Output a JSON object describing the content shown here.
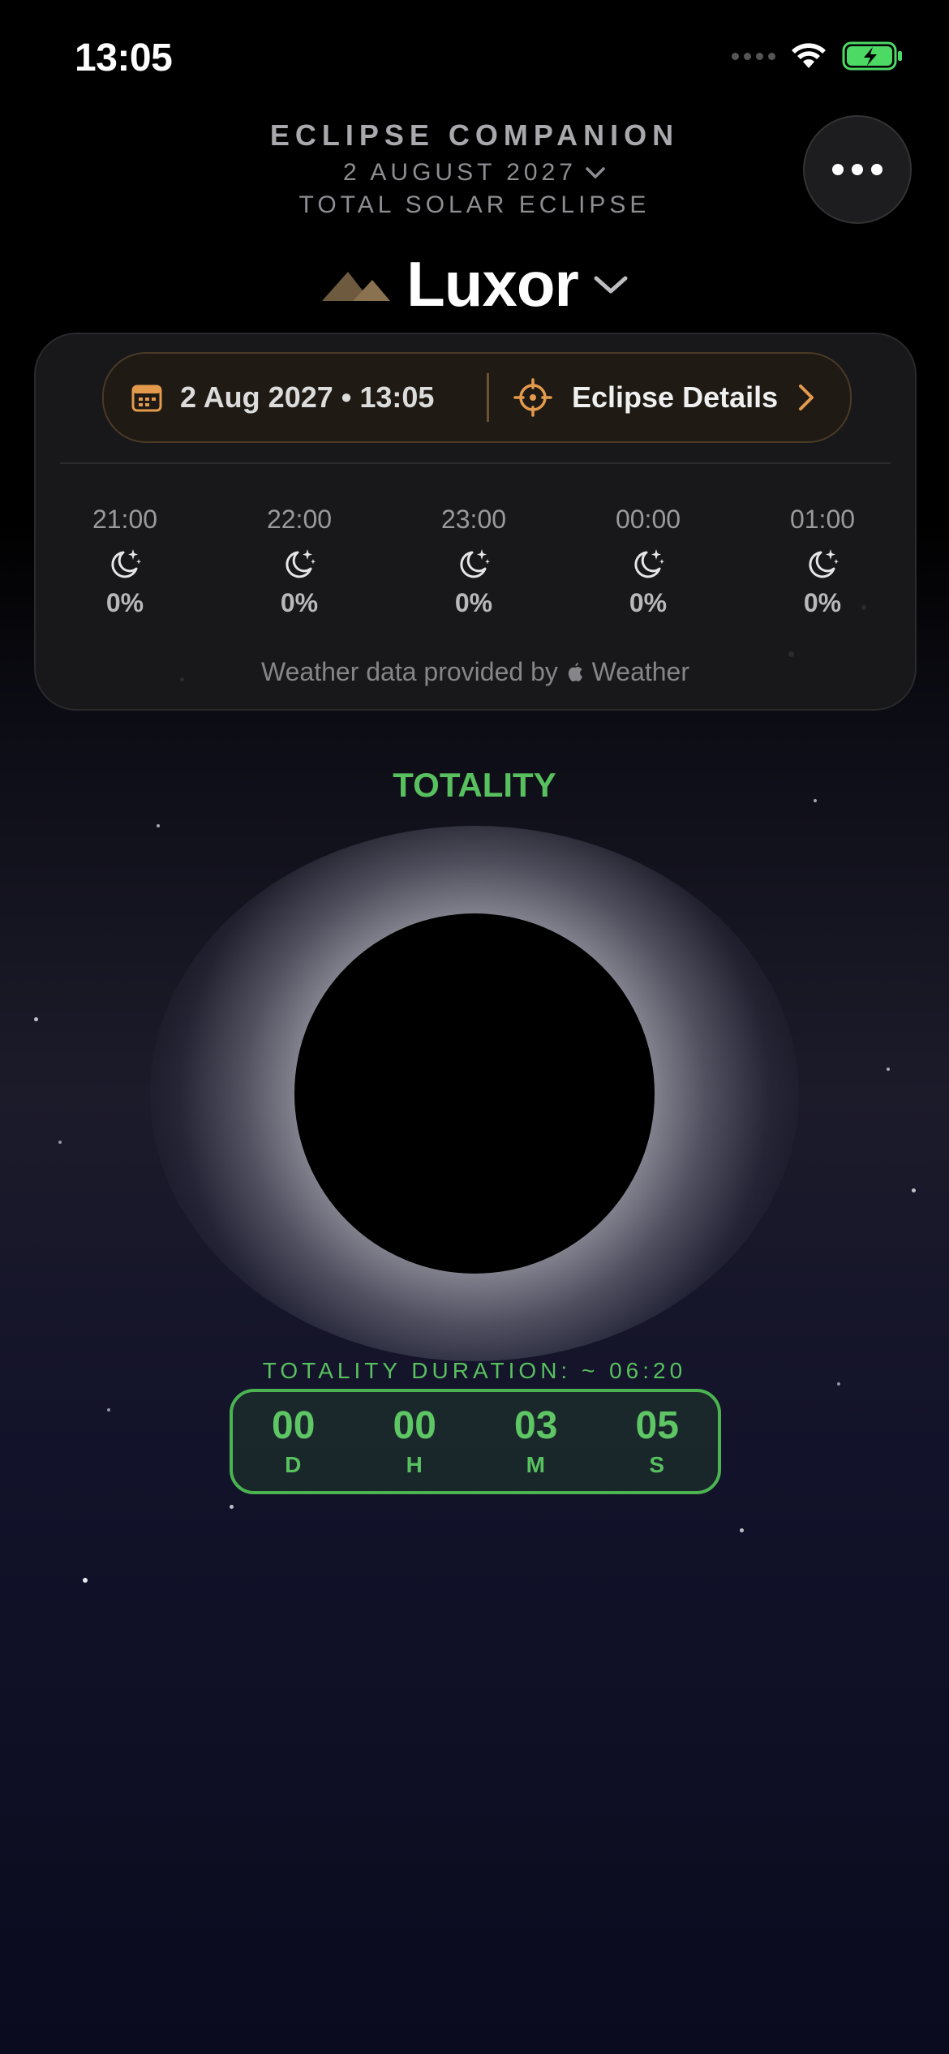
{
  "status_bar": {
    "time": "13:05"
  },
  "header": {
    "app_title": "ECLIPSE COMPANION",
    "date": "2 AUGUST 2027",
    "eclipse_type": "TOTAL SOLAR ECLIPSE",
    "location": "Luxor"
  },
  "card": {
    "datetime": "2 Aug 2027 • 13:05",
    "details_label": "Eclipse Details",
    "hourly": [
      {
        "time": "21:00",
        "icon": "moon-stars-icon",
        "percent": "0%"
      },
      {
        "time": "22:00",
        "icon": "moon-stars-icon",
        "percent": "0%"
      },
      {
        "time": "23:00",
        "icon": "moon-stars-icon",
        "percent": "0%"
      },
      {
        "time": "00:00",
        "icon": "moon-stars-icon",
        "percent": "0%"
      },
      {
        "time": "01:00",
        "icon": "moon-stars-icon",
        "percent": "0%"
      }
    ],
    "weather_credit_prefix": "Weather data provided by",
    "weather_credit_brand": "Weather"
  },
  "totality": {
    "label": "TOTALITY",
    "duration_label": "TOTALITY DURATION: ~ 06:20",
    "countdown": [
      {
        "value": "00",
        "unit": "D"
      },
      {
        "value": "00",
        "unit": "H"
      },
      {
        "value": "03",
        "unit": "M"
      },
      {
        "value": "05",
        "unit": "S"
      }
    ]
  },
  "colors": {
    "accent_orange": "#e39a4c",
    "totality_green": "#58c05e",
    "battery_green": "#4cd964"
  }
}
